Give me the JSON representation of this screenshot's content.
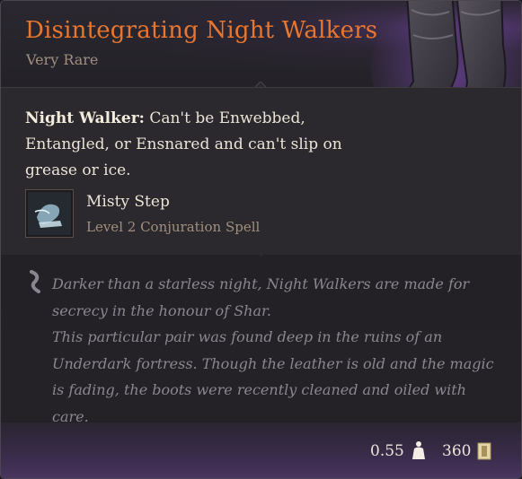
{
  "item": {
    "name": "Disintegrating Night Walkers",
    "rarity": "Very Rare",
    "passive": {
      "label": "Night Walker:",
      "text": " Can't be Enwebbed, Entangled, or Ensnared and can't slip on grease or ice."
    },
    "spell": {
      "name": "Misty Step",
      "level": "Level 2 Conjuration Spell",
      "icon": "misty-step-icon"
    },
    "flavor": [
      "Darker than a starless night, Night Walkers are made for secrecy in the honour of Shar.",
      "This particular pair was found deep in the ruins of an Underdark fortress. Though the leather is old and the magic is fading, the boots were recently cleaned and oiled with care."
    ],
    "weight": "0.55",
    "value": "360"
  },
  "colors": {
    "title": "#e8762f",
    "rarity": "#a08f7f",
    "text": "#ece4d8",
    "flavor": "#8c8690",
    "glow": "#7a46aa"
  }
}
